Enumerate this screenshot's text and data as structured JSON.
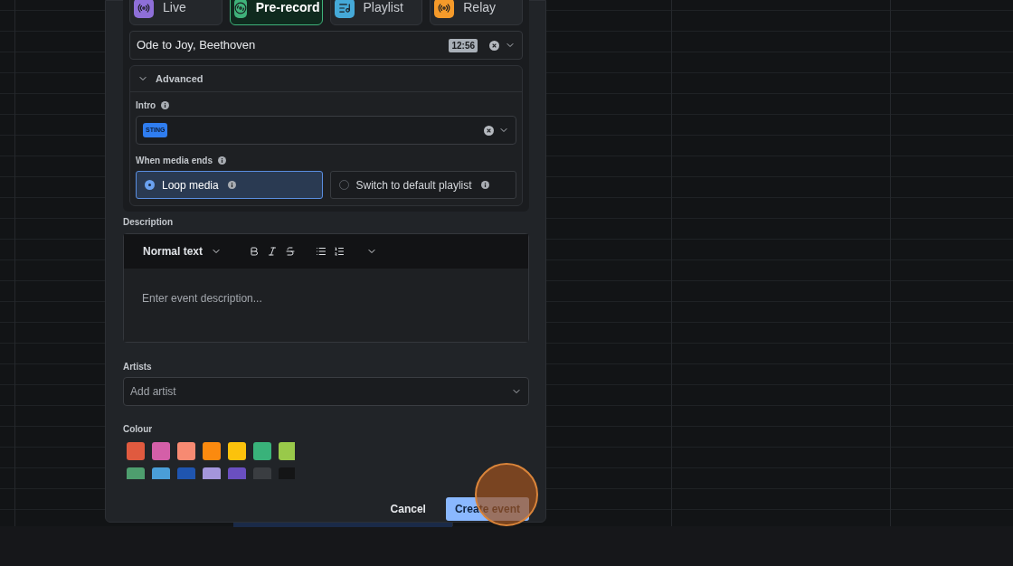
{
  "source_tabs": [
    {
      "label": "Live",
      "selected": false,
      "color": "#8e6fd8"
    },
    {
      "label": "Pre-record",
      "selected": true,
      "color": "#3fb27a"
    },
    {
      "label": "Playlist",
      "selected": false,
      "color": "#45a9d8"
    },
    {
      "label": "Relay",
      "selected": false,
      "color": "#f59a2a"
    }
  ],
  "media_field": {
    "value": "Ode to Joy, Beethoven",
    "duration": "12:56"
  },
  "advanced": {
    "label": "Advanced",
    "expanded": true,
    "intro": {
      "label": "Intro",
      "tag": "STING"
    },
    "media_end": {
      "label": "When media ends",
      "options": [
        {
          "label": "Loop media",
          "selected": true
        },
        {
          "label": "Switch to default playlist",
          "selected": false
        }
      ]
    }
  },
  "description": {
    "label": "Description",
    "text_style": "Normal text",
    "placeholder": "Enter event description..."
  },
  "artists": {
    "label": "Artists",
    "placeholder": "Add artist"
  },
  "colour": {
    "label": "Colour",
    "swatches": [
      {
        "color": "#e05a3f"
      },
      {
        "color": "#d45fa8"
      },
      {
        "color": "#f78a72"
      },
      {
        "color": "#fb8a0f"
      },
      {
        "color": "#fcc20c"
      },
      {
        "color": "#39b27a"
      },
      {
        "color": "#99c94a"
      },
      {
        "color": "#4e9e6e"
      },
      {
        "color": "#4a9ed8"
      },
      {
        "color": "#1f55b0"
      },
      {
        "color": "#a496dc"
      },
      {
        "color": "#6a4fc0"
      },
      {
        "color": "#3a3d41"
      },
      {
        "color": "#141516"
      }
    ]
  },
  "buttons": {
    "cancel": "Cancel",
    "create": "Create event"
  }
}
